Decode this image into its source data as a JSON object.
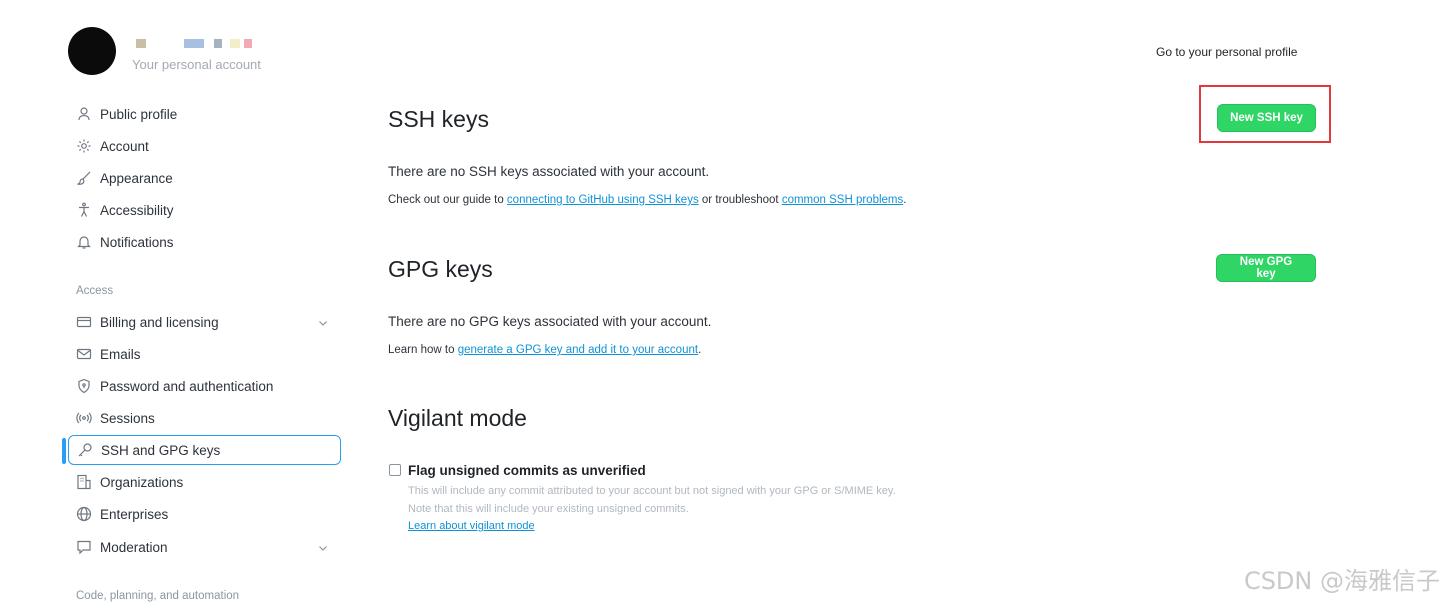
{
  "header": {
    "account_subtitle": "Your personal account",
    "profile_link": "Go to your personal profile",
    "username_blocks": [
      "#c9bfa7",
      "#a7c0df",
      "#a7b2c0",
      "#f2efc8",
      "#f1aab4"
    ]
  },
  "sidebar": {
    "items": [
      {
        "label": "Public profile",
        "icon": "person-icon"
      },
      {
        "label": "Account",
        "icon": "gear-icon"
      },
      {
        "label": "Appearance",
        "icon": "paintbrush-icon"
      },
      {
        "label": "Accessibility",
        "icon": "accessibility-icon"
      },
      {
        "label": "Notifications",
        "icon": "bell-icon"
      }
    ],
    "access_label": "Access",
    "access_items": [
      {
        "label": "Billing and licensing",
        "icon": "credit-card-icon",
        "expandable": true
      },
      {
        "label": "Emails",
        "icon": "mail-icon"
      },
      {
        "label": "Password and authentication",
        "icon": "shield-lock-icon"
      },
      {
        "label": "Sessions",
        "icon": "broadcast-icon"
      },
      {
        "label": "SSH and GPG keys",
        "icon": "key-icon",
        "active": true
      },
      {
        "label": "Organizations",
        "icon": "organization-icon"
      },
      {
        "label": "Enterprises",
        "icon": "globe-icon"
      },
      {
        "label": "Moderation",
        "icon": "report-icon",
        "expandable": true
      }
    ],
    "code_label": "Code, planning, and automation"
  },
  "ssh": {
    "title": "SSH keys",
    "button": "New SSH key",
    "empty": "There are no SSH keys associated with your account.",
    "guide_pre": "Check out our guide to ",
    "guide_link1": "connecting to GitHub using SSH keys",
    "guide_mid": " or troubleshoot ",
    "guide_link2": "common SSH problems",
    "guide_post": "."
  },
  "gpg": {
    "title": "GPG keys",
    "button": "New GPG key",
    "empty": "There are no GPG keys associated with your account.",
    "learn_pre": "Learn how to ",
    "learn_link": "generate a GPG key and add it to your account",
    "learn_post": "."
  },
  "vigilant": {
    "title": "Vigilant mode",
    "checkbox_label": "Flag unsigned commits as unverified",
    "note1": "This will include any commit attributed to your account but not signed with your GPG or S/MIME key.",
    "note2": "Note that this will include your existing unsigned commits.",
    "link": "Learn about vigilant mode"
  },
  "watermark": "CSDN @海雅信子",
  "colors": {
    "accent": "#2a9df4",
    "green_button": "#2fd565",
    "highlight": "#e0393e",
    "link": "#0f93d6"
  }
}
